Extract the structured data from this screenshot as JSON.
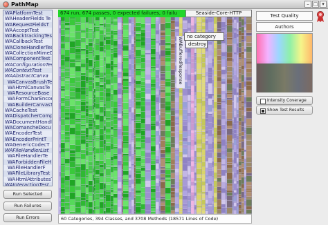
{
  "window": {
    "title": "PathMap"
  },
  "class_list": {
    "items": [
      "WAPlatformTest",
      "WAHeaderFields Te",
      "WARequestFieldsT",
      "WAAcceptTest",
      "WABacktrackingTes",
      "WACallbackTest",
      "WACloneHandlerTes",
      "WACollectionMimeD",
      "WAComponentTest",
      "WAConfigurationTes",
      "WAContextTest",
      "WAAbstractCanva",
      "WACanvasBrushTe",
      "WAHtmlCanvasTe",
      "WAResourceBase",
      "WAFormCharEncod",
      "WABuilderCanvasTe",
      "WACacheTest",
      "WADispatcherComp",
      "WADocumentHandle",
      "WAComancheDocu",
      "WAEncoderTest",
      "WAEncoderPrintT",
      "WAGenericCodecT",
      "WAFileHandlerList",
      "WAFileHandlerTe",
      "WAForbiddenFileH",
      "WAFileHandlerF",
      "WAFileLibraryTest",
      "WAHtmlAttributesT",
      "WAInteractionTest"
    ]
  },
  "buttons": {
    "run_selected": "Run Selected",
    "run_failures": "Run Failures",
    "run_errors": "Run Errors"
  },
  "treemap": {
    "status": "674 run, 674 passes, 0 expected failures, 0 failu",
    "package": "Seaside-Core-HTTP",
    "vertical_label": "WABufferedResponse",
    "category_popup": "no category",
    "method_popup": "destroy",
    "footer": "60 Categories, 394 Classes, and 3708 Methods (18571 Lines of Code)"
  },
  "right_panel": {
    "test_quality": "Test Quality",
    "authors": "Authors",
    "intensity_coverage": "Intensity Coverage",
    "show_test_results": "Show Test Results",
    "intensity_checked": false,
    "show_results_checked": true
  },
  "colors": {
    "pass_green": "#22d62a",
    "class_text": "#1a1f6a",
    "treemap_bg": "#c8c0e4"
  },
  "icons": {
    "close": "close-icon",
    "window_controls": [
      "collapse-icon",
      "maximize-icon",
      "menu-icon"
    ],
    "ribbon": "ribbon-icon"
  }
}
